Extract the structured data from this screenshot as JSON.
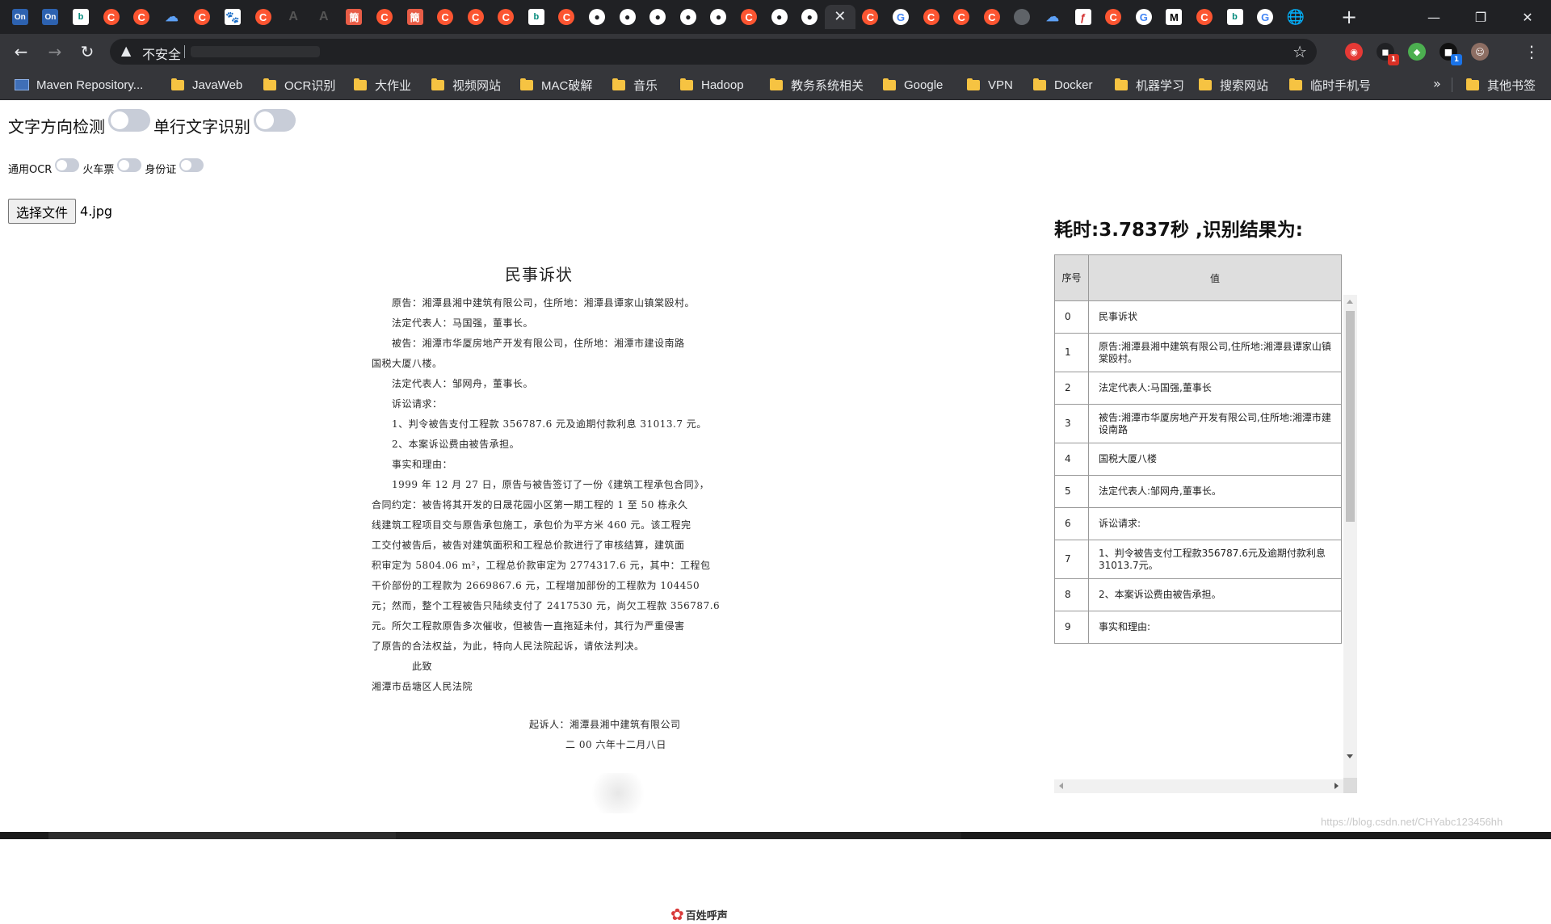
{
  "browser": {
    "tabs": [
      {
        "icon": "on-icon",
        "glyph": "On",
        "style": "on"
      },
      {
        "icon": "on-icon",
        "glyph": "On",
        "style": "on"
      },
      {
        "icon": "bing-icon",
        "glyph": "b",
        "style": "bing"
      },
      {
        "icon": "csdn-icon",
        "glyph": "C",
        "style": "csdn"
      },
      {
        "icon": "csdn-icon",
        "glyph": "C",
        "style": "csdn"
      },
      {
        "icon": "cloud-icon",
        "glyph": "☁",
        "style": "cloud"
      },
      {
        "icon": "csdn-icon",
        "glyph": "C",
        "style": "csdn"
      },
      {
        "icon": "baidu-paw-icon",
        "glyph": "🐾",
        "style": "paw"
      },
      {
        "icon": "csdn-icon",
        "glyph": "C",
        "style": "csdn"
      },
      {
        "icon": "faint-a-icon",
        "glyph": "A",
        "style": "faint"
      },
      {
        "icon": "faint-a-icon",
        "glyph": "A",
        "style": "faint"
      },
      {
        "icon": "jian-icon",
        "glyph": "簡",
        "style": "jian"
      },
      {
        "icon": "csdn-icon",
        "glyph": "C",
        "style": "csdn"
      },
      {
        "icon": "jian-icon",
        "glyph": "簡",
        "style": "jian"
      },
      {
        "icon": "csdn-icon",
        "glyph": "C",
        "style": "csdn"
      },
      {
        "icon": "csdn-icon",
        "glyph": "C",
        "style": "csdn"
      },
      {
        "icon": "csdn-icon",
        "glyph": "C",
        "style": "csdn"
      },
      {
        "icon": "bing-icon",
        "glyph": "b",
        "style": "bing"
      },
      {
        "icon": "csdn-icon",
        "glyph": "C",
        "style": "csdn"
      },
      {
        "icon": "github-icon",
        "glyph": "●",
        "style": "gh"
      },
      {
        "icon": "github-icon",
        "glyph": "●",
        "style": "gh"
      },
      {
        "icon": "github-icon",
        "glyph": "●",
        "style": "gh"
      },
      {
        "icon": "github-icon",
        "glyph": "●",
        "style": "gh"
      },
      {
        "icon": "github-icon",
        "glyph": "●",
        "style": "gh"
      },
      {
        "icon": "csdn-icon",
        "glyph": "C",
        "style": "csdn"
      },
      {
        "icon": "github-icon",
        "glyph": "●",
        "style": "gh"
      },
      {
        "icon": "github-icon",
        "glyph": "●",
        "style": "gh"
      },
      {
        "icon": "close-icon",
        "glyph": "✕",
        "style": "active"
      },
      {
        "icon": "csdn-icon",
        "glyph": "C",
        "style": "csdn"
      },
      {
        "icon": "google-icon",
        "glyph": "G",
        "style": "g"
      },
      {
        "icon": "csdn-icon",
        "glyph": "C",
        "style": "csdn"
      },
      {
        "icon": "csdn-icon",
        "glyph": "C",
        "style": "csdn"
      },
      {
        "icon": "csdn-icon",
        "glyph": "C",
        "style": "csdn"
      },
      {
        "icon": "grey-globe-icon",
        "glyph": "",
        "style": "grey"
      },
      {
        "icon": "cloud-icon",
        "glyph": "☁",
        "style": "cloud"
      },
      {
        "icon": "feather-icon",
        "glyph": "ƒ",
        "style": "fire"
      },
      {
        "icon": "csdn-icon",
        "glyph": "C",
        "style": "csdn"
      },
      {
        "icon": "google-icon",
        "glyph": "G",
        "style": "g"
      },
      {
        "icon": "medium-icon",
        "glyph": "M",
        "style": "m"
      },
      {
        "icon": "csdn-icon",
        "glyph": "C",
        "style": "csdn"
      },
      {
        "icon": "bing-icon",
        "glyph": "b",
        "style": "bing"
      },
      {
        "icon": "google-icon",
        "glyph": "G",
        "style": "g"
      },
      {
        "icon": "globe-icon",
        "glyph": "🌐",
        "style": "globe"
      }
    ],
    "new_tab_glyph": "+",
    "window_controls": {
      "minimize": "—",
      "maximize": "❐",
      "close": "✕"
    },
    "toolbar": {
      "back": "←",
      "forward": "→",
      "reload": "↻",
      "warning_glyph": "▲",
      "security_text": "不安全",
      "bookmark_star": "☆",
      "menu": "⋮",
      "extensions": [
        {
          "name": "adblock-extension-icon",
          "glyph": "◉",
          "color": "#e53935",
          "badge": ""
        },
        {
          "name": "message-extension-icon",
          "glyph": "◼",
          "color": "#202124",
          "badge": "1",
          "badge_color": "#d93025"
        },
        {
          "name": "color-extension-icon",
          "glyph": "◆",
          "color": "#4caf50",
          "badge": ""
        },
        {
          "name": "cube-extension-icon",
          "glyph": "■",
          "color": "#111",
          "badge": "1",
          "badge_color": "#1a73e8"
        },
        {
          "name": "profile-avatar",
          "glyph": "☺",
          "color": "#8d6e63",
          "badge": ""
        }
      ]
    },
    "bookmarks": [
      {
        "label": "Maven Repository...",
        "type": "mvn"
      },
      {
        "label": "JavaWeb",
        "type": "folder"
      },
      {
        "label": "OCR识别",
        "type": "folder"
      },
      {
        "label": "大作业",
        "type": "folder"
      },
      {
        "label": "视频网站",
        "type": "folder"
      },
      {
        "label": "MAC破解",
        "type": "folder"
      },
      {
        "label": "音乐",
        "type": "folder"
      },
      {
        "label": "Hadoop",
        "type": "folder"
      },
      {
        "label": "教务系统相关",
        "type": "folder"
      },
      {
        "label": "Google",
        "type": "folder"
      },
      {
        "label": "VPN",
        "type": "folder"
      },
      {
        "label": "Docker",
        "type": "folder"
      },
      {
        "label": "机器学习",
        "type": "folder"
      },
      {
        "label": "搜索网站",
        "type": "folder"
      },
      {
        "label": "临时手机号",
        "type": "folder"
      }
    ],
    "bookmarks_overflow": "»",
    "other_bookmarks": "其他书签"
  },
  "page": {
    "toggle_direction_label": "文字方向检测",
    "toggle_singleline_label": "单行文字识别",
    "mode_general": "通用OCR",
    "mode_train": "火车票",
    "mode_idcard": "身份证",
    "file_button": "选择文件",
    "file_name": "4.jpg",
    "result_title": "耗时:3.7837秒 ,识别结果为:",
    "table": {
      "header_index": "序号",
      "header_value": "值",
      "rows": [
        {
          "idx": "0",
          "value": "民事诉状"
        },
        {
          "idx": "1",
          "value": "原告:湘潭县湘中建筑有限公司,住所地:湘潭县谭家山镇棠殴村。"
        },
        {
          "idx": "2",
          "value": "法定代表人:马国强,董事长"
        },
        {
          "idx": "3",
          "value": "被告:湘潭市华厦房地产开发有限公司,住所地:湘潭市建设南路"
        },
        {
          "idx": "4",
          "value": "国税大厦八楼"
        },
        {
          "idx": "5",
          "value": "法定代表人:邹网舟,董事长。"
        },
        {
          "idx": "6",
          "value": "诉讼请求:"
        },
        {
          "idx": "7",
          "value": "1、判令被告支付工程款356787.6元及逾期付款利息31013.7元。"
        },
        {
          "idx": "8",
          "value": "2、本案诉讼费由被告承担。"
        },
        {
          "idx": "9",
          "value": "事实和理由:"
        }
      ]
    },
    "document": {
      "title": "民事诉状",
      "lines": [
        "原告：湘潭县湘中建筑有限公司，住所地：湘潭县谭家山镇棠殴村。",
        "法定代表人：马国强，董事长。",
        "被告：湘潭市华厦房地产开发有限公司，住所地：湘潭市建设南路",
        "国税大厦八楼。",
        "法定代表人：邹网舟，董事长。",
        "诉讼请求：",
        "1、判令被告支付工程款 356787.6 元及逾期付款利息 31013.7 元。",
        "2、本案诉讼费由被告承担。",
        "事实和理由：",
        "1999 年 12 月 27 日，原告与被告签订了一份《建筑工程承包合同》，",
        "合同约定：被告将其开发的日晟花园小区第一期工程的 1 至 50 栋永久",
        "线建筑工程项目交与原告承包施工，承包价为平方米 460 元。该工程完",
        "工交付被告后，被告对建筑面积和工程总价款进行了审核结算，建筑面",
        "积审定为 5804.06 m²，工程总价款审定为 2774317.6 元，其中：工程包",
        "干价部份的工程款为 2669867.6 元，工程增加部份的工程款为 104450",
        "元；然而，整个工程被告只陆续支付了 2417530 元，尚欠工程款 356787.6",
        "元。所欠工程款原告多次催收，但被告一直拖延未付，其行为严重侵害",
        "了原告的合法权益，为此，特向人民法院起诉，请依法判决。",
        "此致",
        "湘潭市岳塘区人民法院",
        "起诉人：湘潭县湘中建筑有限公司",
        "二 00 六年十二月八日"
      ],
      "logo_text": "百姓呼声"
    },
    "footer_watermark": "https://blog.csdn.net/CHYabc123456hh"
  }
}
